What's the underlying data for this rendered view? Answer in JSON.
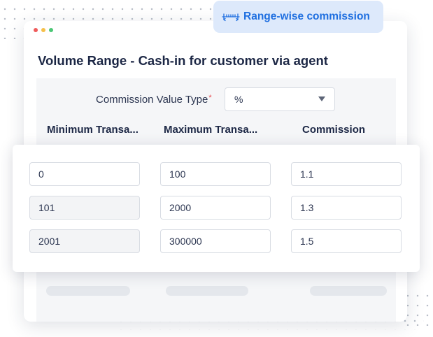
{
  "badge": {
    "icon": "ruler-range-icon",
    "label": "Range-wise commission",
    "text_color": "#1f6fe0",
    "background": "#dde9fb"
  },
  "card": {
    "title": "Volume Range - Cash-in for customer via agent"
  },
  "commission_value_type": {
    "label": "Commission Value Type",
    "required_marker": "*",
    "selected": "%"
  },
  "table": {
    "headers": [
      "Minimum Transa...",
      "Maximum Transa...",
      "Commission"
    ],
    "rows": [
      {
        "min": "0",
        "max": "100",
        "commission": "1.1"
      },
      {
        "min": "101",
        "max": "2000",
        "commission": "1.3"
      },
      {
        "min": "2001",
        "max": "300000",
        "commission": "1.5"
      }
    ]
  },
  "colors": {
    "title": "#1c2745",
    "required": "#e5484d",
    "window_dots": [
      "#ef5b5b",
      "#f5c04a",
      "#4cc776"
    ]
  }
}
